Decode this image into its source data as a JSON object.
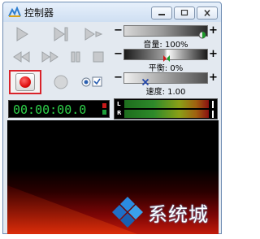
{
  "window": {
    "title": "控制器"
  },
  "sliders": {
    "volume": {
      "label": "音量: 100%",
      "value_percent": 100
    },
    "balance": {
      "label": "平衡: 0%",
      "value_percent": 0
    },
    "speed": {
      "label": "速度: 1.00",
      "value": 1.0
    }
  },
  "timecode": {
    "value": "00:00:00.0"
  },
  "meter": {
    "left_label": "L",
    "right_label": "R"
  },
  "watermark": {
    "text": "系统城"
  },
  "icons": {
    "play": "play-icon",
    "skip_end": "skip-to-end-icon",
    "step": "step-forward-icon",
    "rewind": "rewind-icon",
    "fast_forward": "fast-forward-icon",
    "pause": "pause-icon",
    "stop": "stop-icon",
    "record": "record-icon",
    "loop": "record-loop-icon",
    "options": "options-check-icon"
  },
  "colors": {
    "record_highlight": "#d9232b",
    "timecode_text": "#2fd34a"
  }
}
